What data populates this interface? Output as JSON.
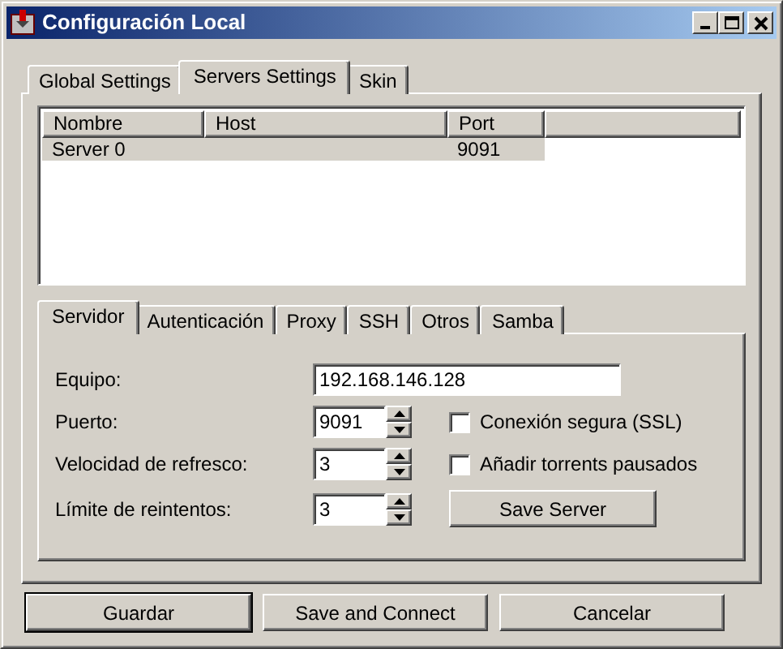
{
  "window": {
    "title": "Configuración Local"
  },
  "tabs": [
    {
      "label": "Global Settings",
      "selected": false
    },
    {
      "label": "Servers Settings",
      "selected": true
    },
    {
      "label": "Skin",
      "selected": false
    }
  ],
  "servers_table": {
    "columns": [
      "Nombre",
      "Host",
      "Port"
    ],
    "rows": [
      {
        "nombre": "Server 0",
        "port": "9091",
        "selected": true
      }
    ]
  },
  "server_tabs": [
    {
      "label": "Servidor",
      "selected": true
    },
    {
      "label": "Autenticación",
      "selected": false
    },
    {
      "label": "Proxy",
      "selected": false
    },
    {
      "label": "SSH",
      "selected": false
    },
    {
      "label": "Otros",
      "selected": false
    },
    {
      "label": "Samba",
      "selected": false
    }
  ],
  "form": {
    "host": {
      "label": "Equipo:",
      "value": "192.168.146.128"
    },
    "rows": [
      {
        "label": "Puerto:",
        "value": "9091",
        "side": {
          "kind": "checkbox",
          "label": "Conexión segura (SSL)",
          "checked": false
        }
      },
      {
        "label": "Velocidad de refresco:",
        "value": "3",
        "side": {
          "kind": "checkbox",
          "label": "Añadir torrents pausados",
          "checked": false
        }
      },
      {
        "label": "Límite de reintentos:",
        "value": "3",
        "side": {
          "kind": "button",
          "label": "Save Server"
        }
      }
    ]
  },
  "buttons": [
    {
      "label": "Guardar",
      "default": true
    },
    {
      "label": "Save and Connect",
      "default": false
    },
    {
      "label": "Cancelar",
      "default": false
    }
  ]
}
